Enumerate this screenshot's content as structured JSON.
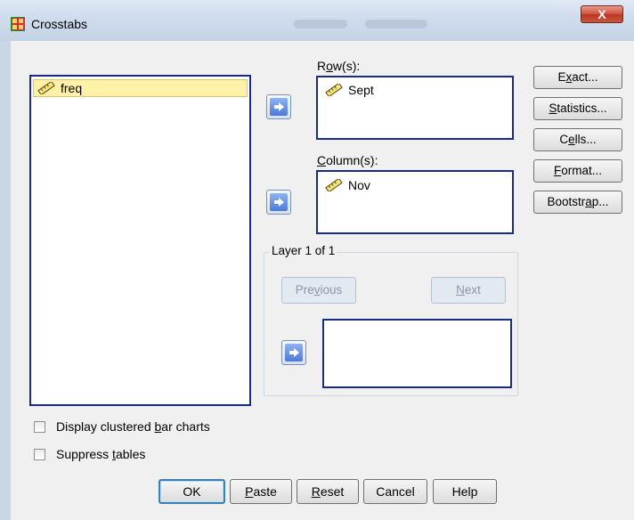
{
  "window": {
    "title": "Crosstabs",
    "close_label": "X"
  },
  "variable_list": {
    "items": [
      {
        "name": "freq",
        "selected": true
      }
    ]
  },
  "rows": {
    "label_pre": "R",
    "label_u": "o",
    "label_post": "w(s):",
    "items": [
      "Sept"
    ]
  },
  "columns": {
    "label_pre": "",
    "label_u": "C",
    "label_post": "olumn(s):",
    "items": [
      "Nov"
    ]
  },
  "layer": {
    "legend": "Layer 1 of 1",
    "previous": {
      "pre": "Pre",
      "u": "v",
      "post": "ious"
    },
    "next": {
      "pre": "",
      "u": "N",
      "post": "ext"
    },
    "items": []
  },
  "side_buttons": {
    "exact": {
      "pre": "E",
      "u": "x",
      "post": "act..."
    },
    "statistics": {
      "pre": "",
      "u": "S",
      "post": "tatistics..."
    },
    "cells": {
      "pre": "C",
      "u": "e",
      "post": "lls..."
    },
    "format": {
      "pre": "",
      "u": "F",
      "post": "ormat..."
    },
    "bootstrap": {
      "pre": "Bootstr",
      "u": "a",
      "post": "p..."
    }
  },
  "options": {
    "clustered": {
      "pre": "Display clustered ",
      "u": "b",
      "post": "ar charts",
      "checked": false
    },
    "suppress": {
      "pre": "Suppress ",
      "u": "t",
      "post": "ables",
      "checked": false
    }
  },
  "bottom_buttons": {
    "ok": "OK",
    "paste": {
      "pre": "",
      "u": "P",
      "post": "aste"
    },
    "reset": {
      "pre": "",
      "u": "R",
      "post": "eset"
    },
    "cancel": "Cancel",
    "help": "Help"
  },
  "colors": {
    "list_border": "#1a2a88",
    "selection": "#fff2a8",
    "arrow": "#4c7ad8"
  }
}
